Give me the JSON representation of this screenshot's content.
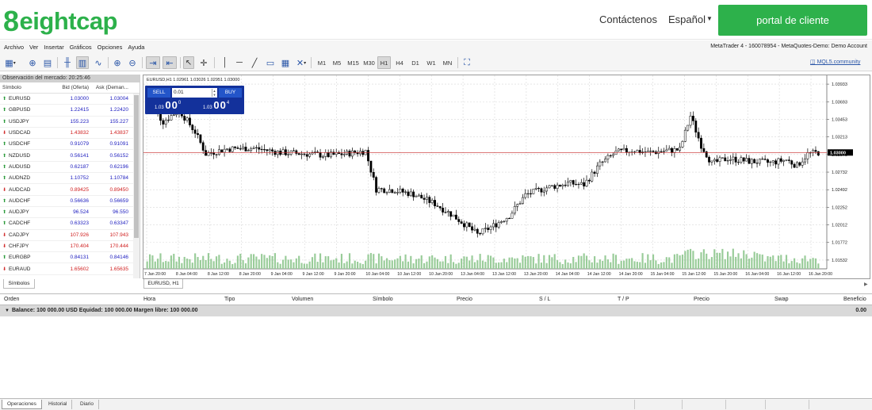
{
  "site": {
    "logo_text": "eightcap",
    "logo_mark": "8",
    "nav_contact": "Contáctenos",
    "nav_language": "Español",
    "portal_button": "portal de cliente"
  },
  "menu": {
    "items": [
      "Archivo",
      "Ver",
      "Insertar",
      "Gráficos",
      "Opciones",
      "Ayuda"
    ],
    "account_info": "MetaTrader 4 - 160078954 - MetaQuotes-Demo: Demo Account"
  },
  "toolbar": {
    "timeframes": [
      "M1",
      "M5",
      "M15",
      "M30",
      "H1",
      "H4",
      "D1",
      "W1",
      "MN"
    ],
    "active_timeframe": "H1",
    "mql5_link": "MQL5.community"
  },
  "market_watch": {
    "title": "Observación del mercado: 20:25:46",
    "col_symbol": "Símbolo",
    "col_bid": "Bid (Oferta)",
    "col_ask": "Ask (Deman...",
    "rows": [
      {
        "symbol": "EURUSD",
        "bid": "1.03000",
        "ask": "1.03004",
        "dir": "up"
      },
      {
        "symbol": "GBPUSD",
        "bid": "1.22415",
        "ask": "1.22420",
        "dir": "up"
      },
      {
        "symbol": "USDJPY",
        "bid": "155.223",
        "ask": "155.227",
        "dir": "up"
      },
      {
        "symbol": "USDCAD",
        "bid": "1.43832",
        "ask": "1.43837",
        "dir": "down"
      },
      {
        "symbol": "USDCHF",
        "bid": "0.91079",
        "ask": "0.91091",
        "dir": "up"
      },
      {
        "symbol": "NZDUSD",
        "bid": "0.56141",
        "ask": "0.56152",
        "dir": "up"
      },
      {
        "symbol": "AUDUSD",
        "bid": "0.62187",
        "ask": "0.62196",
        "dir": "up"
      },
      {
        "symbol": "AUDNZD",
        "bid": "1.10752",
        "ask": "1.10784",
        "dir": "up"
      },
      {
        "symbol": "AUDCAD",
        "bid": "0.89425",
        "ask": "0.89450",
        "dir": "down"
      },
      {
        "symbol": "AUDCHF",
        "bid": "0.56636",
        "ask": "0.56659",
        "dir": "up"
      },
      {
        "symbol": "AUDJPY",
        "bid": "96.524",
        "ask": "96.550",
        "dir": "up"
      },
      {
        "symbol": "CADCHF",
        "bid": "0.63323",
        "ask": "0.63347",
        "dir": "up"
      },
      {
        "symbol": "CADJPY",
        "bid": "107.926",
        "ask": "107.943",
        "dir": "down"
      },
      {
        "symbol": "CHFJPY",
        "bid": "170.404",
        "ask": "170.444",
        "dir": "down"
      },
      {
        "symbol": "EURGBP",
        "bid": "0.84131",
        "ask": "0.84146",
        "dir": "up"
      },
      {
        "symbol": "EURAUD",
        "bid": "1.65602",
        "ask": "1.65635",
        "dir": "down"
      }
    ],
    "tab": "Símbolos"
  },
  "chart": {
    "info": "EURUSD,H1  1.02961 1.03026 1.02951 1.03000",
    "tab": "EURUSD, H1",
    "current_price": "1.03000",
    "price_ticks": [
      "1.03933",
      "1.03693",
      "1.03453",
      "1.03213",
      "1.02973",
      "1.02732",
      "1.02492",
      "1.02252",
      "1.02012",
      "1.01772",
      "1.01532"
    ],
    "time_ticks": [
      "7 Jan 20:00",
      "8 Jan 04:00",
      "8 Jan 12:00",
      "8 Jan 20:00",
      "9 Jan 04:00",
      "9 Jan 12:00",
      "9 Jan 20:00",
      "10 Jan 04:00",
      "10 Jan 12:00",
      "10 Jan 20:00",
      "13 Jan 04:00",
      "13 Jan 12:00",
      "13 Jan 20:00",
      "14 Jan 04:00",
      "14 Jan 12:00",
      "14 Jan 20:00",
      "15 Jan 04:00",
      "15 Jan 12:00",
      "15 Jan 20:00",
      "16 Jan 04:00",
      "16 Jan 12:00",
      "16 Jan 20:00"
    ],
    "one_click": {
      "sell_label": "SELL",
      "buy_label": "BUY",
      "lot": "0.01",
      "sell_prefix": "1.03",
      "sell_big": "00",
      "sell_sup": "0",
      "buy_prefix": "1.03",
      "buy_big": "00",
      "buy_sup": "4"
    }
  },
  "terminal": {
    "columns": [
      "Orden",
      "Hora",
      "Tipo",
      "Volumen",
      "Símbolo",
      "Precio",
      "S / L",
      "T / P",
      "Precio",
      "Swap",
      "Beneficio"
    ],
    "balance_line": "Balance: 100 000.00 USD  Equidad: 100 000.00  Margen libre: 100 000.00",
    "balance_value": "0.00",
    "tabs": [
      "Operaciones",
      "Historial",
      "Diario"
    ]
  }
}
